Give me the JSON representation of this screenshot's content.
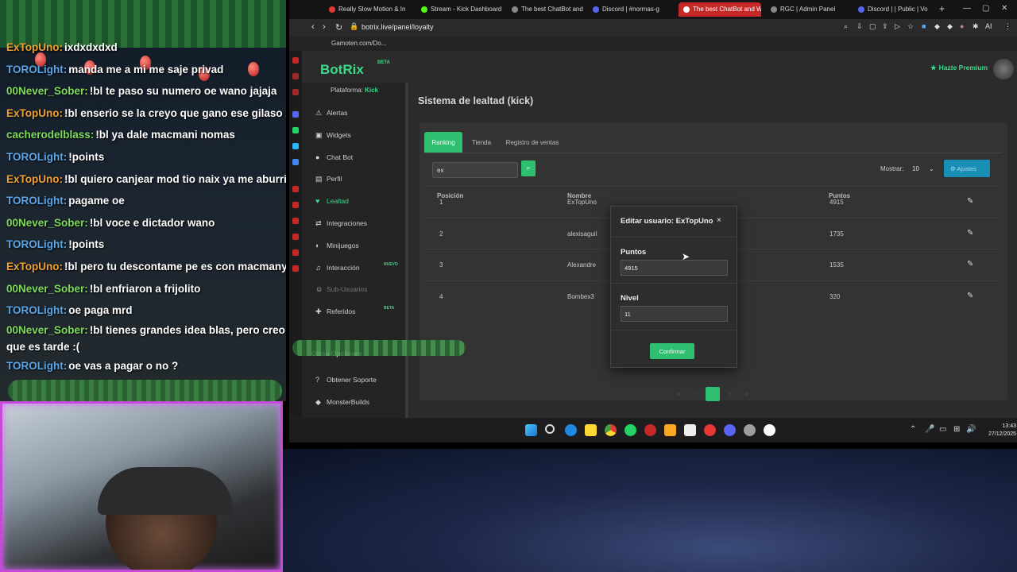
{
  "chat": {
    "messages": [
      {
        "user": "ExTopUno:",
        "text": "ixdxdxdxd",
        "color": "#f0a030"
      },
      {
        "user": "TOROLight:",
        "text": "manda me a mi me saje privad",
        "color": "#5aa6e8"
      },
      {
        "user": "00Never_Sober:",
        "text": "!bl te paso su numero oe wano jajaja",
        "color": "#7ddc5a"
      },
      {
        "user": "ExTopUno:",
        "text": "!bl enserio se la creyo que gano ese gilaso xDDD",
        "color": "#f0a030"
      },
      {
        "user": "cacherodelblass:",
        "text": "!bl ya dale macmani nomas",
        "color": "#7ddc5a"
      },
      {
        "user": "TOROLight:",
        "text": "!points",
        "color": "#5aa6e8"
      },
      {
        "user": "ExTopUno:",
        "text": "!bl quiero canjear mod tio naix ya me aburri del m",
        "color": "#f0a030"
      },
      {
        "user": "TOROLight:",
        "text": "pagame oe",
        "color": "#5aa6e8"
      },
      {
        "user": "00Never_Sober:",
        "text": "!bl voce e dictador wano",
        "color": "#7ddc5a"
      },
      {
        "user": "TOROLight:",
        "text": "!points",
        "color": "#5aa6e8"
      },
      {
        "user": "ExTopUno:",
        "text": "!bl pero tu descontame pe es con macmanys",
        "color": "#f0a030"
      },
      {
        "user": "00Never_Sober:",
        "text": "!bl enfriaron a frijolito",
        "color": "#7ddc5a"
      },
      {
        "user": "TOROLight:",
        "text": "oe paga mrd",
        "color": "#5aa6e8"
      },
      {
        "user": "00Never_Sober:",
        "text": "!bl tienes grandes idea blas, pero creo que es tarde :(",
        "color": "#7ddc5a"
      },
      {
        "user": "TOROLight:",
        "text": "oe vas a pagar o no ?",
        "color": "#5aa6e8"
      }
    ]
  },
  "browser": {
    "tabs": [
      {
        "label": "Really Slow Motion & In",
        "fav": "#e53935"
      },
      {
        "label": "Stream - Kick Dashboard",
        "fav": "#53fc18"
      },
      {
        "label": "The best ChatBot and Wid",
        "fav": "#888888"
      },
      {
        "label": "Discord | #normas-g",
        "fav": "#5865f2"
      },
      {
        "label": "The best ChatBot and Wid",
        "fav": "#ffffff"
      },
      {
        "label": "RGC | Admin Panel",
        "fav": "#888888"
      },
      {
        "label": "Discord | | Public | Vo",
        "fav": "#5865f2"
      }
    ],
    "new_tab": "+",
    "window_controls": [
      "—",
      "▢",
      "✕"
    ],
    "nav": {
      "back": "‹",
      "forward": "›",
      "reload": "↻"
    },
    "url": "botrix.live/panel/loyalty",
    "bookmark": "Gamoten.com/Do...",
    "ext_label": "AI"
  },
  "app": {
    "logo": "BotRix",
    "logo_beta": "BETA",
    "premium": "Hazte Premium",
    "platform_label": "Plataforma:",
    "platform_value": "Kick",
    "nav": [
      {
        "label": "Alertas",
        "icon": "⚠",
        "state": ""
      },
      {
        "label": "Widgets",
        "icon": "▣",
        "state": ""
      },
      {
        "label": "Chat Bot",
        "icon": "●",
        "state": ""
      },
      {
        "label": "Perfil",
        "icon": "▤",
        "state": ""
      },
      {
        "label": "Lealtad",
        "icon": "♥",
        "state": "active"
      },
      {
        "label": "Integraciones",
        "icon": "⇄",
        "state": ""
      },
      {
        "label": "Minijuegos",
        "icon": "◐",
        "state": ""
      },
      {
        "label": "Interacción",
        "icon": "♫",
        "state": "",
        "tag": "NUEVO"
      },
      {
        "label": "Sub-Usuarios",
        "icon": "☺",
        "state": "dim"
      },
      {
        "label": "Referidos",
        "icon": "✚",
        "state": "",
        "tag": "BETA"
      }
    ],
    "other_section": "Otras Opciones",
    "other_nav": [
      {
        "label": "Obtener Soporte",
        "icon": "?"
      },
      {
        "label": "MonsterBuilds",
        "icon": "◆"
      }
    ],
    "page_title": "Sistema de lealtad (kick)",
    "tabs": [
      "Ranking",
      "Tienda",
      "Registro de ventas"
    ],
    "search_value": "ex",
    "show_label": "Mostrar:",
    "show_value": "10",
    "settings_label": "Ajustes",
    "columns": [
      "Posición",
      "Nombre",
      "Puntos"
    ],
    "rows": [
      {
        "pos": "1",
        "name": "ExTopUno",
        "points": "4915"
      },
      {
        "pos": "2",
        "name": "alexisaguil",
        "points": "1735"
      },
      {
        "pos": "3",
        "name": "Alexandre",
        "points": "1535"
      },
      {
        "pos": "4",
        "name": "Bombex3",
        "points": "320"
      }
    ],
    "pager": [
      "«",
      "‹",
      "1",
      "›",
      "»"
    ]
  },
  "modal": {
    "title": "Editar usuario: ExTopUno",
    "close": "×",
    "points_label": "Puntos",
    "points_value": "4915",
    "level_label": "Nivel",
    "level_value": "11",
    "confirm": "Confirmar"
  },
  "taskbar": {
    "time": "13:43",
    "date": "27/12/2025",
    "tray": [
      "⌃",
      "🎤",
      "▭",
      "⊞",
      "🔊"
    ]
  }
}
